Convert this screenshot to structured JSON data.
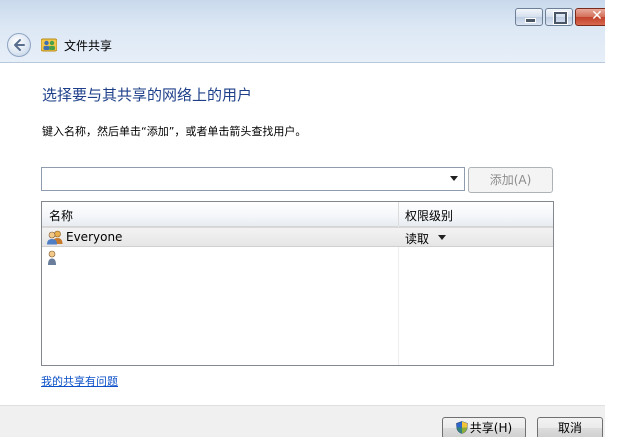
{
  "window": {
    "title": "文件共享",
    "controls": {
      "minimize": "minimize-icon",
      "maximize": "maximize-icon",
      "close": "close-icon"
    }
  },
  "main": {
    "heading": "选择要与其共享的网络上的用户",
    "instruction": "键入名称，然后单击“添加”，或者单击箭头查找用户。",
    "combo": {
      "value": ""
    },
    "add_label": "添加(A)",
    "list": {
      "columns": {
        "name": "名称",
        "permission": "权限级别"
      },
      "rows": [
        {
          "name": "Everyone",
          "permission": "读取",
          "icon": "users-group-icon"
        },
        {
          "name": "",
          "permission": "",
          "icon": "user-icon"
        }
      ]
    },
    "help_link": "我的共享有问题"
  },
  "footer": {
    "share_label": "共享(H)",
    "cancel_label": "取消"
  },
  "colors": {
    "heading": "#1e3f8a",
    "link": "#0b50c8",
    "titlebar": "#c9d9ec"
  }
}
